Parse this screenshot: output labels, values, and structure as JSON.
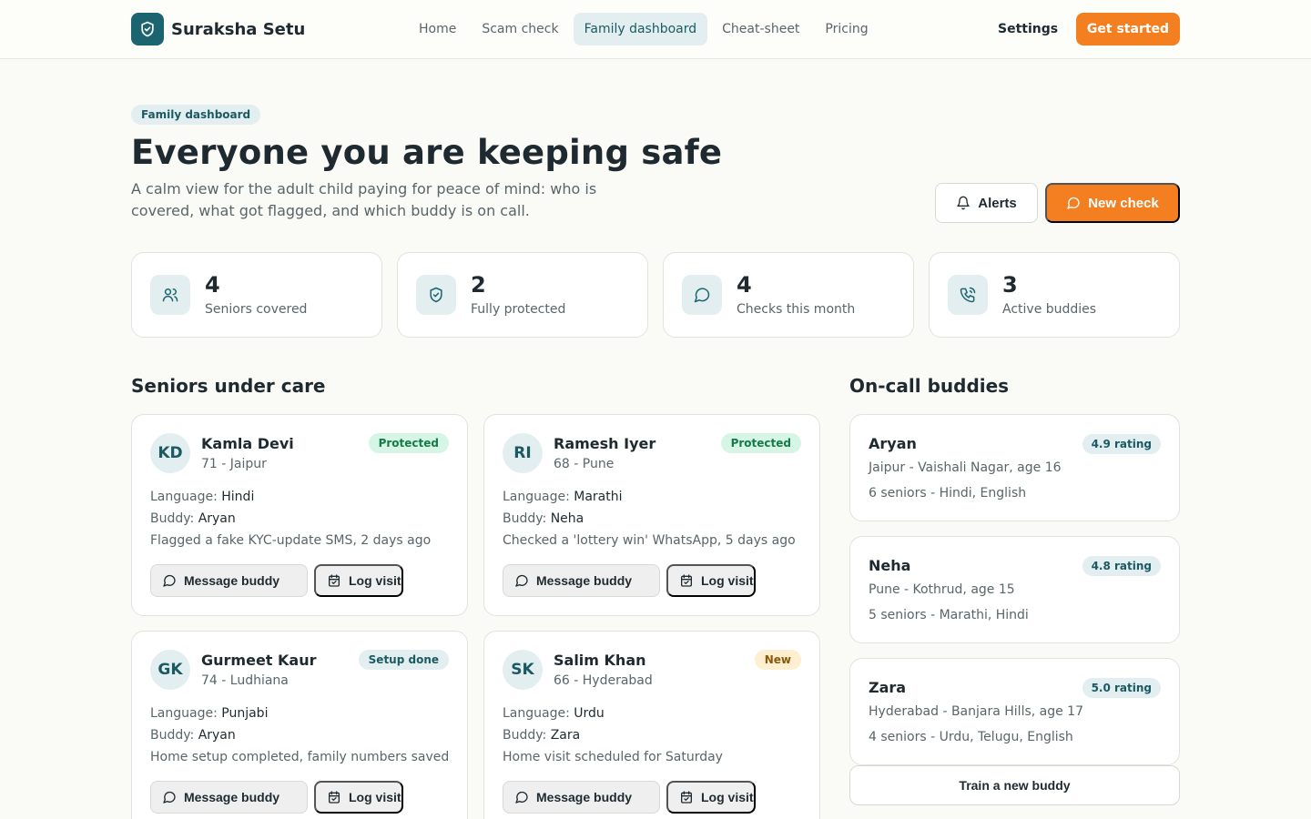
{
  "header": {
    "brand": "Suraksha Setu",
    "nav": [
      "Home",
      "Scam check",
      "Family dashboard",
      "Cheat-sheet",
      "Pricing"
    ],
    "active_nav": "Family dashboard",
    "settings": "Settings",
    "cta": "Get started"
  },
  "hero": {
    "pill": "Family dashboard",
    "title": "Everyone you are keeping safe",
    "subtitle": "A calm view for the adult child paying for peace of mind: who is covered, what got flagged, and which buddy is on call.",
    "alerts_button": "Alerts",
    "new_check_button": "New check"
  },
  "stats": [
    {
      "value": "4",
      "label": "Seniors covered",
      "icon": "users-icon"
    },
    {
      "value": "2",
      "label": "Fully protected",
      "icon": "shield-icon"
    },
    {
      "value": "4",
      "label": "Checks this month",
      "icon": "chat-icon"
    },
    {
      "value": "3",
      "label": "Active buddies",
      "icon": "phone-icon"
    }
  ],
  "seniors_section": {
    "title": "Seniors under care",
    "language_label": "Language:",
    "buddy_label": "Buddy:",
    "message_button": "Message buddy",
    "log_button": "Log visit",
    "items": [
      {
        "initials": "KD",
        "name": "Kamla Devi",
        "meta": "71 - Jaipur",
        "status": "Protected",
        "language": "Hindi",
        "buddy": "Aryan",
        "note": "Flagged a fake KYC-update SMS, 2 days ago"
      },
      {
        "initials": "RI",
        "name": "Ramesh Iyer",
        "meta": "68 - Pune",
        "status": "Protected",
        "language": "Marathi",
        "buddy": "Neha",
        "note": "Checked a 'lottery win' WhatsApp, 5 days ago"
      },
      {
        "initials": "GK",
        "name": "Gurmeet Kaur",
        "meta": "74 - Ludhiana",
        "status": "Setup done",
        "language": "Punjabi",
        "buddy": "Aryan",
        "note": "Home setup completed, family numbers saved"
      },
      {
        "initials": "SK",
        "name": "Salim Khan",
        "meta": "66 - Hyderabad",
        "status": "New",
        "language": "Urdu",
        "buddy": "Zara",
        "note": "Home visit scheduled for Saturday"
      }
    ]
  },
  "status_colors": {
    "Protected": {
      "bg": "#d6f5e4",
      "fg": "#177a4a"
    },
    "Setup done": {
      "bg": "#e2eef0",
      "fg": "#1c5a63"
    },
    "New": {
      "bg": "#fdefcf",
      "fg": "#8a5a0c"
    }
  },
  "buddies_section": {
    "title": "On-call buddies",
    "items": [
      {
        "name": "Aryan",
        "rating": "4.9 rating",
        "location": "Jaipur - Vaishali Nagar, age 16",
        "info": "6 seniors - Hindi, English"
      },
      {
        "name": "Neha",
        "rating": "4.8 rating",
        "location": "Pune - Kothrud, age 15",
        "info": "5 seniors - Marathi, Hindi"
      },
      {
        "name": "Zara",
        "rating": "5.0 rating",
        "location": "Hyderabad - Banjara Hills, age 17",
        "info": "4 seniors - Urdu, Telugu, English"
      }
    ],
    "train_button": "Train a new buddy"
  },
  "colors": {
    "accent": "#f47f20",
    "brand": "#1c6570",
    "tint": "#e3eef0"
  }
}
